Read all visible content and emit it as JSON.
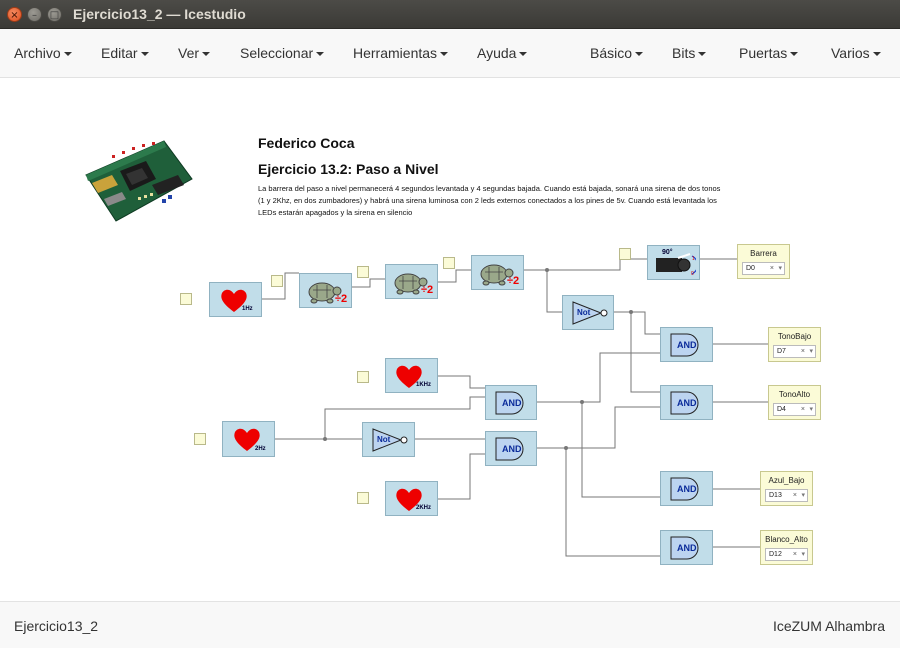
{
  "window": {
    "title": "Ejercicio13_2 — Icestudio"
  },
  "menu_left": [
    "Archivo",
    "Editar",
    "Ver",
    "Seleccionar",
    "Herramientas",
    "Ayuda"
  ],
  "menu_right": [
    "Básico",
    "Bits",
    "Puertas",
    "Varios"
  ],
  "doc": {
    "author": "Federico Coca",
    "title": "Ejercicio 13.2: Paso a Nivel",
    "description": "La barrera del paso a nivel permanecerá 4 segundos levantada y 4 segundas bajada. Cuando está bajada, sonará una sirena de dos tonos (1 y 2Khz, en dos zumbadores) y habrá una sirena luminosa con 2 leds externos conectados a los pines de 5v. Cuando está levantada los LEDs estarán apagados y la sirena en silencio"
  },
  "blocks": {
    "heart_1hz": "1Hz",
    "heart_2hz": "2Hz",
    "heart_1khz": "1KHz",
    "heart_2khz": "2KHz",
    "div_label": "÷2",
    "not_label": "Not",
    "and_label": "AND",
    "servo_label": "90°"
  },
  "outputs": [
    {
      "name": "Barrera",
      "pin": "D0"
    },
    {
      "name": "TonoBajo",
      "pin": "D7"
    },
    {
      "name": "TonoAlto",
      "pin": "D4"
    },
    {
      "name": "Azul_Bajo",
      "pin": "D13"
    },
    {
      "name": "Blanco_Alto",
      "pin": "D12"
    }
  ],
  "status": {
    "project": "Ejercicio13_2",
    "board": "IceZUM Alhambra"
  }
}
